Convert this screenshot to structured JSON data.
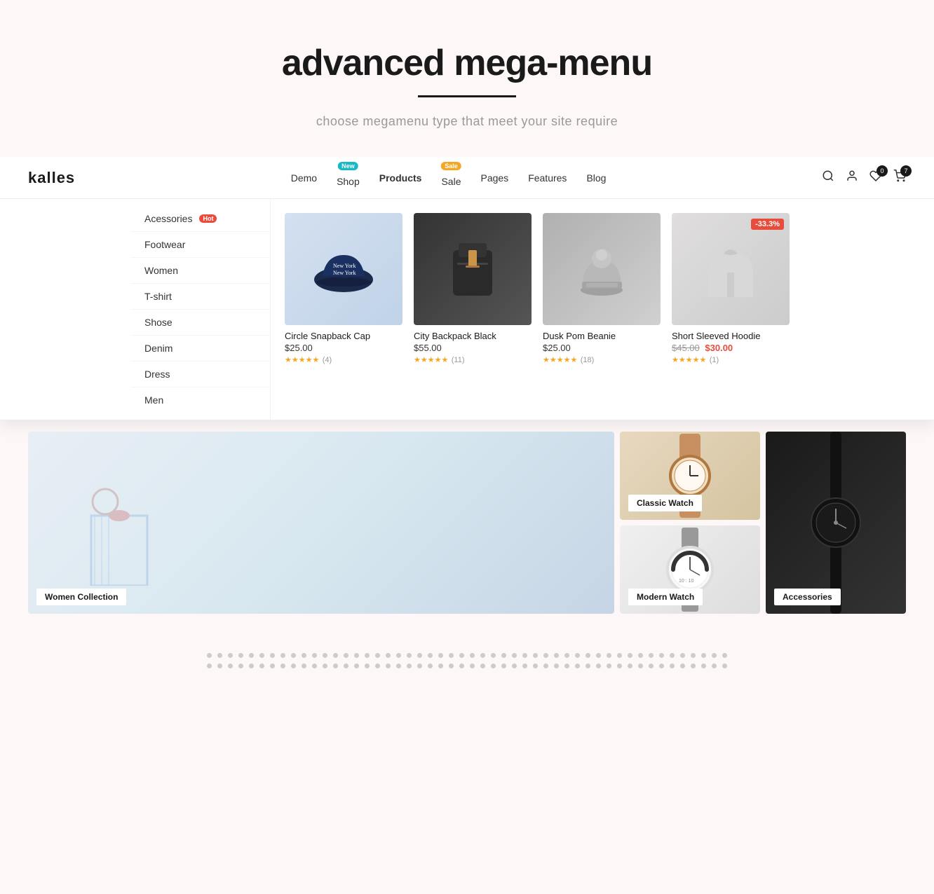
{
  "hero": {
    "title": "advanced mega-menu",
    "divider": true,
    "subtitle": "choose megamenu type that meet your site require"
  },
  "navbar": {
    "logo": "kalles",
    "nav_items": [
      {
        "label": "Demo",
        "badge": null,
        "active": false
      },
      {
        "label": "Shop",
        "badge": "New",
        "badge_type": "new",
        "active": false
      },
      {
        "label": "Products",
        "badge": null,
        "active": true
      },
      {
        "label": "Sale",
        "badge": "Sale",
        "badge_type": "sale",
        "active": false
      },
      {
        "label": "Pages",
        "badge": null,
        "active": false
      },
      {
        "label": "Features",
        "badge": null,
        "active": false
      },
      {
        "label": "Blog",
        "badge": null,
        "active": false
      }
    ],
    "icons": {
      "search": "🔍",
      "user": "👤",
      "wishlist": "♡",
      "wishlist_count": "0",
      "cart": "🛒",
      "cart_count": "7"
    }
  },
  "sidebar": {
    "items": [
      {
        "label": "Acessories",
        "badge": "Hot",
        "badge_type": "hot"
      },
      {
        "label": "Footwear",
        "badge": null
      },
      {
        "label": "Women",
        "badge": null
      },
      {
        "label": "T-shirt",
        "badge": null
      },
      {
        "label": "Shose",
        "badge": null
      },
      {
        "label": "Denim",
        "badge": null
      },
      {
        "label": "Dress",
        "badge": null
      },
      {
        "label": "Men",
        "badge": null
      }
    ]
  },
  "products": [
    {
      "name": "Circle Snapback Cap",
      "price": "$25.00",
      "original_price": null,
      "sale_price": null,
      "discount_badge": null,
      "stars": 5,
      "review_count": 4,
      "image_type": "cap"
    },
    {
      "name": "City Backpack Black",
      "price": "$55.00",
      "original_price": null,
      "sale_price": null,
      "discount_badge": null,
      "stars": 5,
      "review_count": 11,
      "image_type": "backpack"
    },
    {
      "name": "Dusk Pom Beanie",
      "price": "$25.00",
      "original_price": null,
      "sale_price": null,
      "discount_badge": null,
      "stars": 5,
      "review_count": 18,
      "image_type": "beanie"
    },
    {
      "name": "Short Sleeved Hoodie",
      "price": null,
      "original_price": "$45.00",
      "sale_price": "$30.00",
      "discount_badge": "-33.3%",
      "stars": 5,
      "review_count": 1,
      "image_type": "hoodie"
    }
  ],
  "promo": {
    "women_label": "Women Collection",
    "classic_watch_label": "Classic Watch",
    "modern_watch_label": "Modern Watch",
    "accessories_label": "Accessories"
  },
  "dots": {
    "rows": 2,
    "cols": 50
  }
}
